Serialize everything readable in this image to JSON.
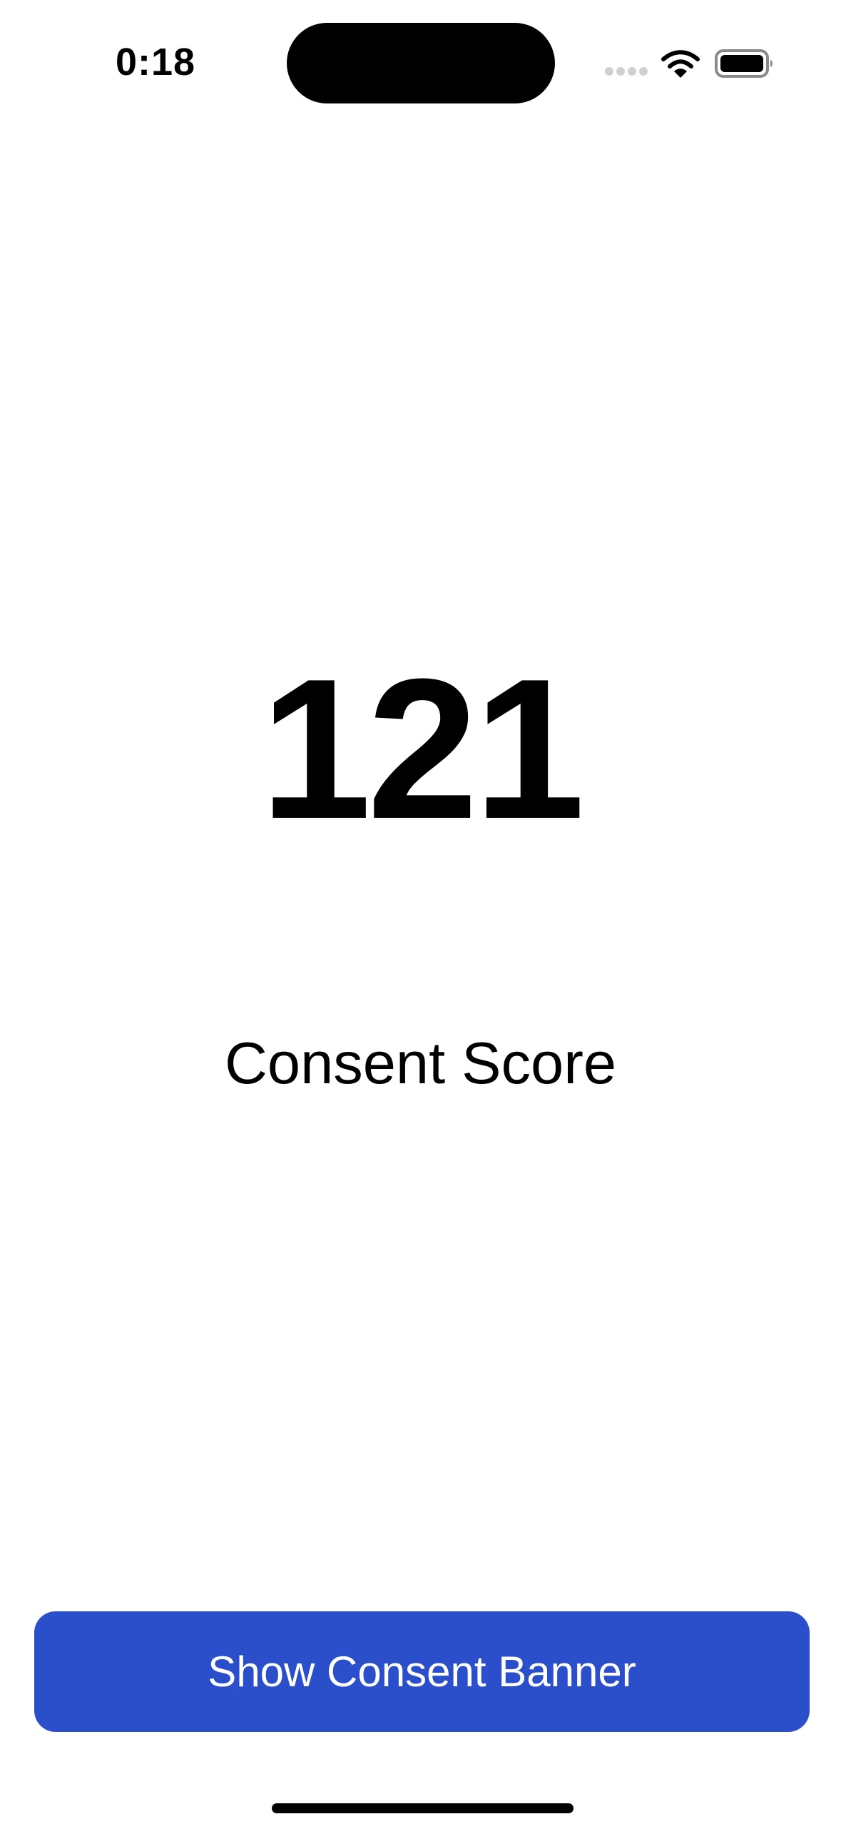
{
  "status_bar": {
    "time": "0:18",
    "icons": [
      "cellular-signal-icon",
      "wifi-icon",
      "battery-icon"
    ]
  },
  "main": {
    "score_value": "121",
    "score_label": "Consent Score"
  },
  "action": {
    "button_label": "Show Consent Banner"
  },
  "colors": {
    "accent": "#2b4ecb",
    "background": "#ffffff",
    "text": "#000000",
    "button_text": "#ffffff",
    "inactive_signal": "#cfcfcf"
  }
}
